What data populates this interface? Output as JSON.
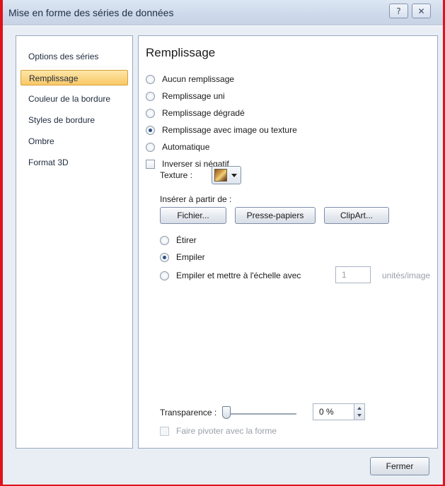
{
  "window": {
    "title": "Mise en forme des séries de données",
    "help_glyph": "?",
    "close_glyph": "✕"
  },
  "nav": {
    "items": [
      {
        "label": "Options des séries",
        "selected": false
      },
      {
        "label": "Remplissage",
        "selected": true
      },
      {
        "label": "Couleur de la bordure",
        "selected": false
      },
      {
        "label": "Styles de bordure",
        "selected": false
      },
      {
        "label": "Ombre",
        "selected": false
      },
      {
        "label": "Format 3D",
        "selected": false
      }
    ]
  },
  "panel": {
    "heading": "Remplissage",
    "fill_options": [
      {
        "label": "Aucun remplissage",
        "checked": false
      },
      {
        "label": "Remplissage uni",
        "checked": false
      },
      {
        "label": "Remplissage dégradé",
        "checked": false
      },
      {
        "label": "Remplissage avec image ou texture",
        "checked": true
      },
      {
        "label": "Automatique",
        "checked": false
      }
    ],
    "invert_if_negative": {
      "label": "Inverser si négatif",
      "checked": false
    },
    "texture": {
      "label": "Texture :",
      "icon": "texture-swatch-icon"
    },
    "insert_from": {
      "label": "Insérer à partir de :",
      "file_button": "Fichier...",
      "clipboard_button": "Presse-papiers",
      "clipart_button": "ClipArt..."
    },
    "stretch_options": [
      {
        "label": "Étirer",
        "checked": false
      },
      {
        "label": "Empiler",
        "checked": true
      },
      {
        "label": "Empiler et mettre à l'échelle avec",
        "checked": false
      }
    ],
    "scale": {
      "value": "1",
      "unit": "unités/image"
    },
    "transparency": {
      "label": "Transparence :",
      "value": "0 %",
      "level": 0
    },
    "rotate_with_shape": {
      "label": "Faire pivoter avec la forme",
      "checked": false,
      "enabled": false
    }
  },
  "footer": {
    "close_button": "Fermer"
  }
}
